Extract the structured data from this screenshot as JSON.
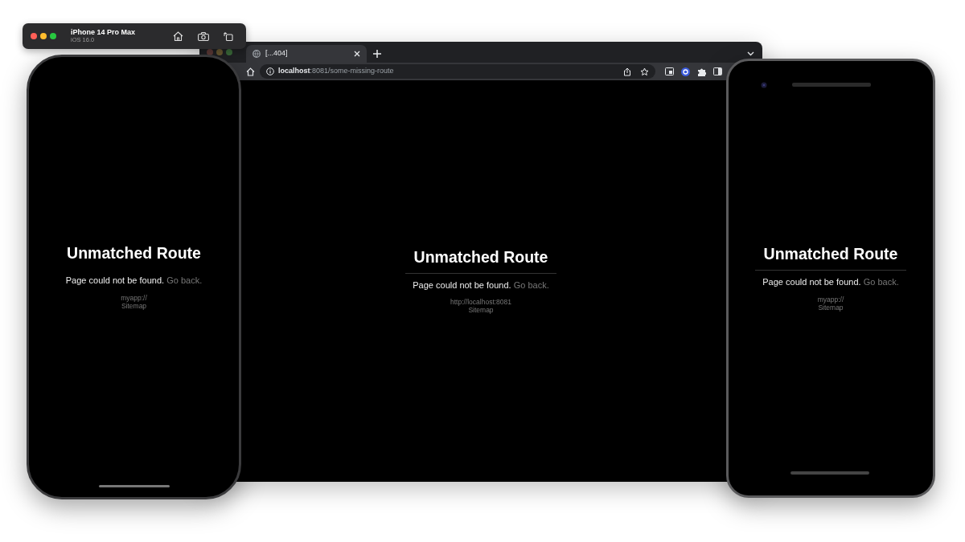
{
  "simulator": {
    "title": "iPhone 14 Pro Max",
    "subtitle": "iOS 16.0"
  },
  "browser": {
    "tab": {
      "title": "[...404]",
      "selected": true
    },
    "address": {
      "host": "localhost",
      "path": ":8081/some-missing-route"
    },
    "screen": {
      "title": "Unmatched Route",
      "divider": true,
      "message": "Page could not be found.",
      "link": "Go back.",
      "url": "http://localhost:8081",
      "sitemap": "Sitemap"
    }
  },
  "iphone": {
    "screen": {
      "title": "Unmatched Route",
      "divider": false,
      "message": "Page could not be found.",
      "link": "Go back.",
      "url": "myapp://",
      "sitemap": "Sitemap"
    }
  },
  "android": {
    "screen": {
      "title": "Unmatched Route",
      "divider": true,
      "message": "Page could not be found.",
      "link": "Go back.",
      "url": "myapp://",
      "sitemap": "Sitemap"
    }
  }
}
